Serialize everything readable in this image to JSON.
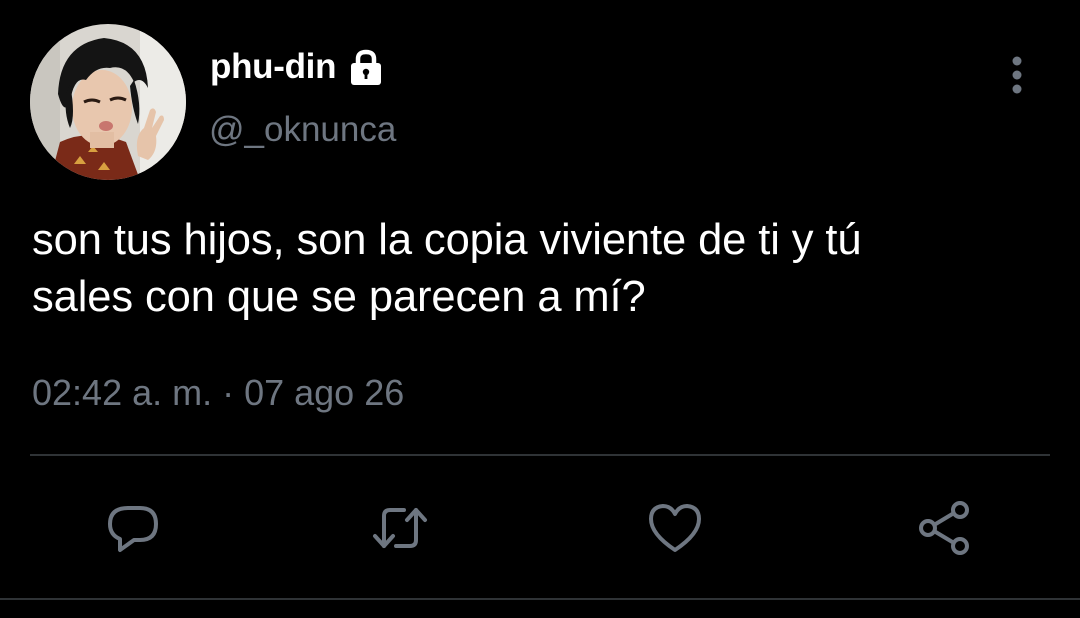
{
  "author": {
    "display_name": "phu-din",
    "handle": "@_oknunca",
    "protected_icon": "lock-icon",
    "avatar": "profile-photo"
  },
  "tweet": {
    "text_line_1": "son tus hijos, son la copia viviente de ti y tú",
    "text_line_2": "sales con que se parecen a mí?",
    "timestamp": "02:42 a. m. · 07 ago 26"
  },
  "actions": {
    "reply_icon": "reply-icon",
    "retweet_icon": "retweet-icon",
    "like_icon": "like-icon",
    "share_icon": "share-icon",
    "more_icon": "more-vertical-icon"
  },
  "colors": {
    "background": "#000000",
    "primary_text": "#ffffff",
    "secondary_text": "#6e7681",
    "icon": "#6e7681",
    "divider": "#2f3336"
  }
}
